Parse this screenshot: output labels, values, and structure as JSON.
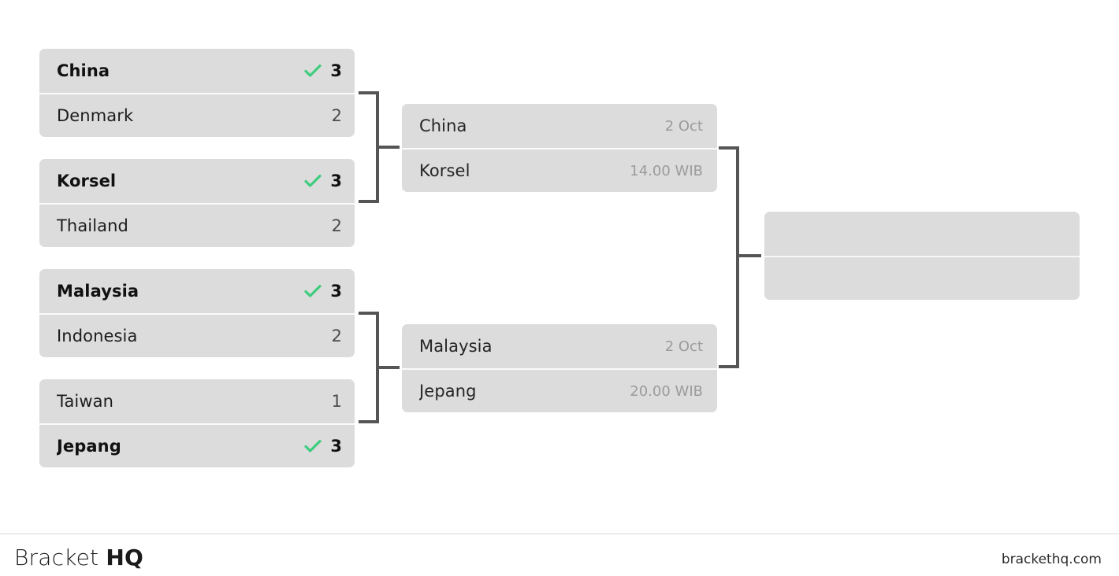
{
  "colors": {
    "page_background": "#ffffff",
    "slot_background": "#dcdcdc",
    "slot_divider": "#fafafa",
    "connector": "#555555",
    "winner_check": "#3ecd7e",
    "meta_text": "#9b9b9b",
    "footer_rule": "#d8d8d8"
  },
  "icons": {
    "winner_check": "check-icon"
  },
  "bracket": {
    "rounds": [
      {
        "name": "round-1",
        "matches": [
          {
            "id": "r1-m1",
            "slots": [
              {
                "team": "China",
                "score": "3",
                "winner": true
              },
              {
                "team": "Denmark",
                "score": "2",
                "winner": false
              }
            ]
          },
          {
            "id": "r1-m2",
            "slots": [
              {
                "team": "Korsel",
                "score": "3",
                "winner": true
              },
              {
                "team": "Thailand",
                "score": "2",
                "winner": false
              }
            ]
          },
          {
            "id": "r1-m3",
            "slots": [
              {
                "team": "Malaysia",
                "score": "3",
                "winner": true
              },
              {
                "team": "Indonesia",
                "score": "2",
                "winner": false
              }
            ]
          },
          {
            "id": "r1-m4",
            "slots": [
              {
                "team": "Taiwan",
                "score": "1",
                "winner": false
              },
              {
                "team": "Jepang",
                "score": "3",
                "winner": true
              }
            ]
          }
        ]
      },
      {
        "name": "round-2",
        "matches": [
          {
            "id": "r2-m1",
            "slots": [
              {
                "team": "China",
                "meta": "2 Oct"
              },
              {
                "team": "Korsel",
                "meta": "14.00 WIB"
              }
            ]
          },
          {
            "id": "r2-m2",
            "slots": [
              {
                "team": "Malaysia",
                "meta": "2 Oct"
              },
              {
                "team": "Jepang",
                "meta": "20.00 WIB"
              }
            ]
          }
        ]
      },
      {
        "name": "round-3",
        "matches": [
          {
            "id": "r3-m1",
            "slots": [
              {
                "team": "",
                "meta": ""
              },
              {
                "team": "",
                "meta": ""
              }
            ]
          }
        ]
      }
    ]
  },
  "footer": {
    "brand_light": "Bracket",
    "brand_bold": "HQ",
    "url": "brackethq.com"
  }
}
